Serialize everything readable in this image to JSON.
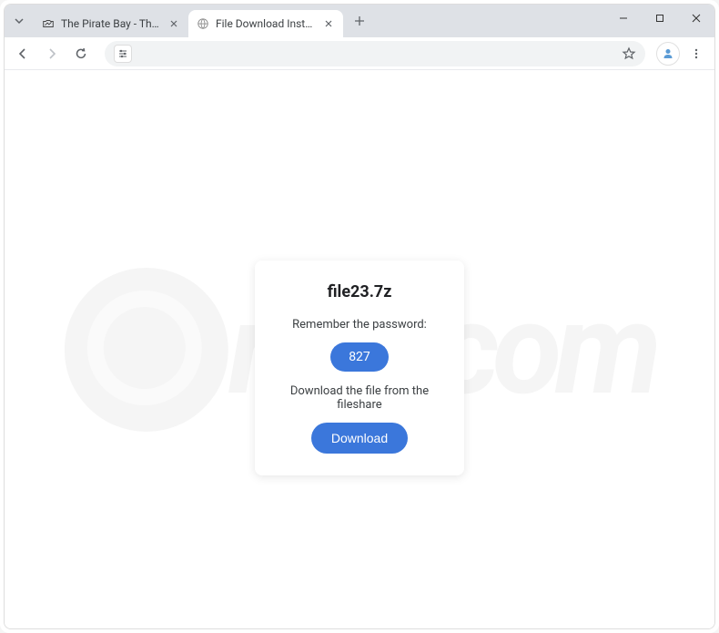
{
  "tabs": [
    {
      "title": "The Pirate Bay - The galaxy's m...",
      "active": false
    },
    {
      "title": "File Download Instructions for f...",
      "active": true
    }
  ],
  "card": {
    "filename": "file23.7z",
    "remember_label": "Remember the password:",
    "password": "827",
    "download_instruction": "Download the file from the fileshare",
    "download_button": "Download"
  },
  "watermark_text": "risk.com"
}
